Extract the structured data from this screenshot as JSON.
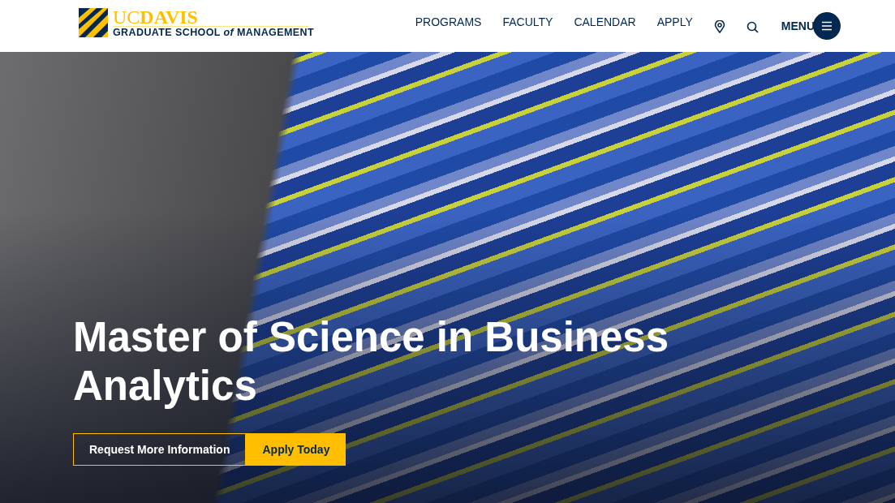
{
  "header": {
    "logo": {
      "wordmark": "UC**DAVIS**",
      "subtitle": "GRADUATE SCHOOL *of* MANAGEMENT"
    },
    "nav": [
      {
        "label": "PROGRAMS"
      },
      {
        "label": "FACULTY"
      },
      {
        "label": "CALENDAR"
      },
      {
        "label": "APPLY"
      }
    ],
    "menu": {
      "label": "MENU"
    }
  },
  "hero": {
    "title": "Master of Science in Business Analytics",
    "buttons": [
      {
        "label": "Request More Information",
        "kind": "outline"
      },
      {
        "label": "Apply Today",
        "kind": "filled"
      }
    ]
  }
}
